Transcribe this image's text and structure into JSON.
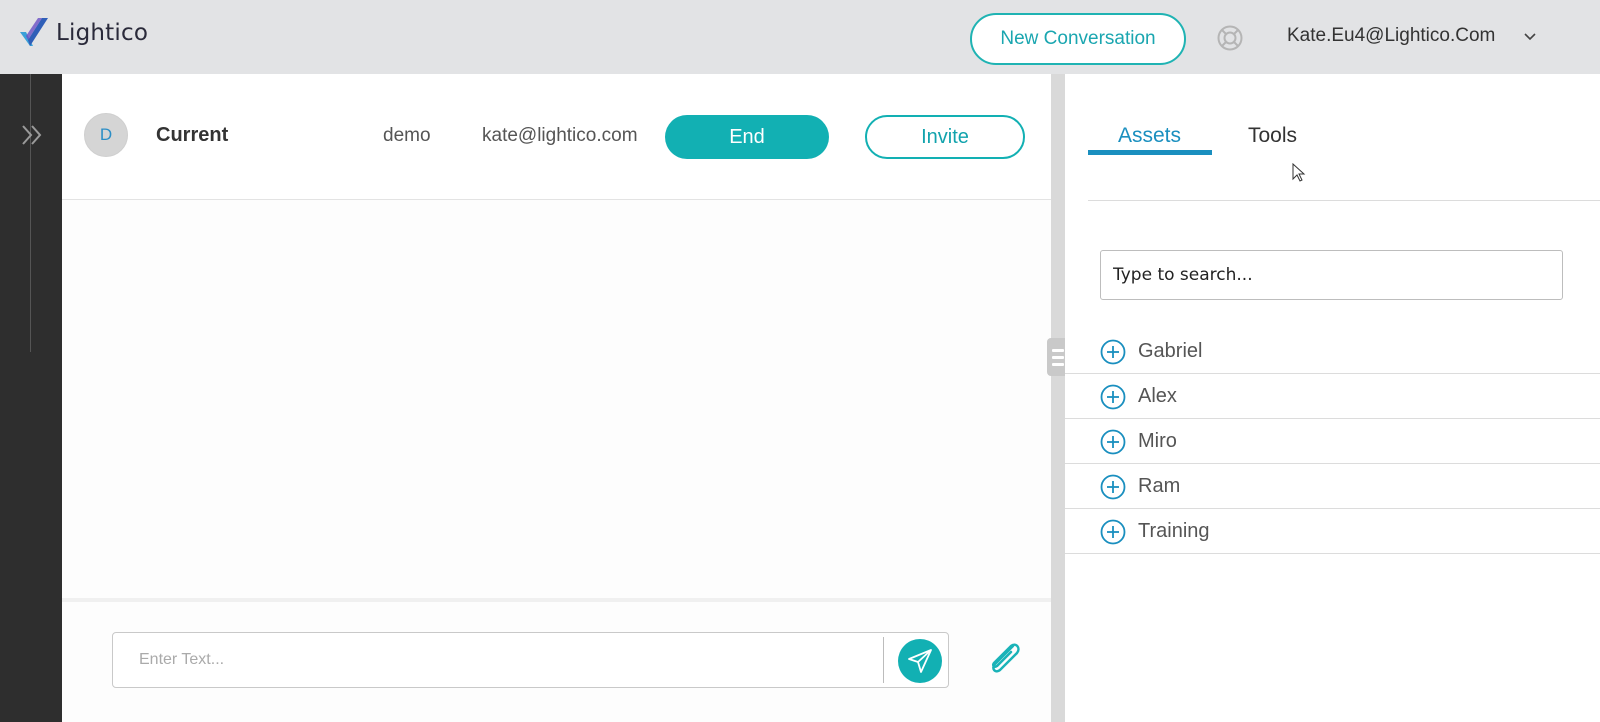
{
  "header": {
    "logo_text": "Lightico",
    "new_conversation_label": "New Conversation",
    "user_email": "Kate.Eu4@Lightico.Com"
  },
  "conversation": {
    "avatar_letter": "D",
    "name": "Current",
    "tag": "demo",
    "email": "kate@lightico.com",
    "end_label": "End",
    "invite_label": "Invite"
  },
  "composer": {
    "placeholder": "Enter Text..."
  },
  "panel": {
    "tabs": [
      {
        "label": "Assets",
        "active": true
      },
      {
        "label": "Tools",
        "active": false
      }
    ],
    "search_placeholder": "Type to search...",
    "assets": [
      {
        "label": "Gabriel"
      },
      {
        "label": "Alex"
      },
      {
        "label": "Miro"
      },
      {
        "label": "Ram"
      },
      {
        "label": "Training"
      }
    ]
  },
  "colors": {
    "accent_teal": "#12b0b3",
    "accent_blue": "#1a8fbf",
    "topbar": "#e2e3e5",
    "rail": "#2e2e2e"
  }
}
